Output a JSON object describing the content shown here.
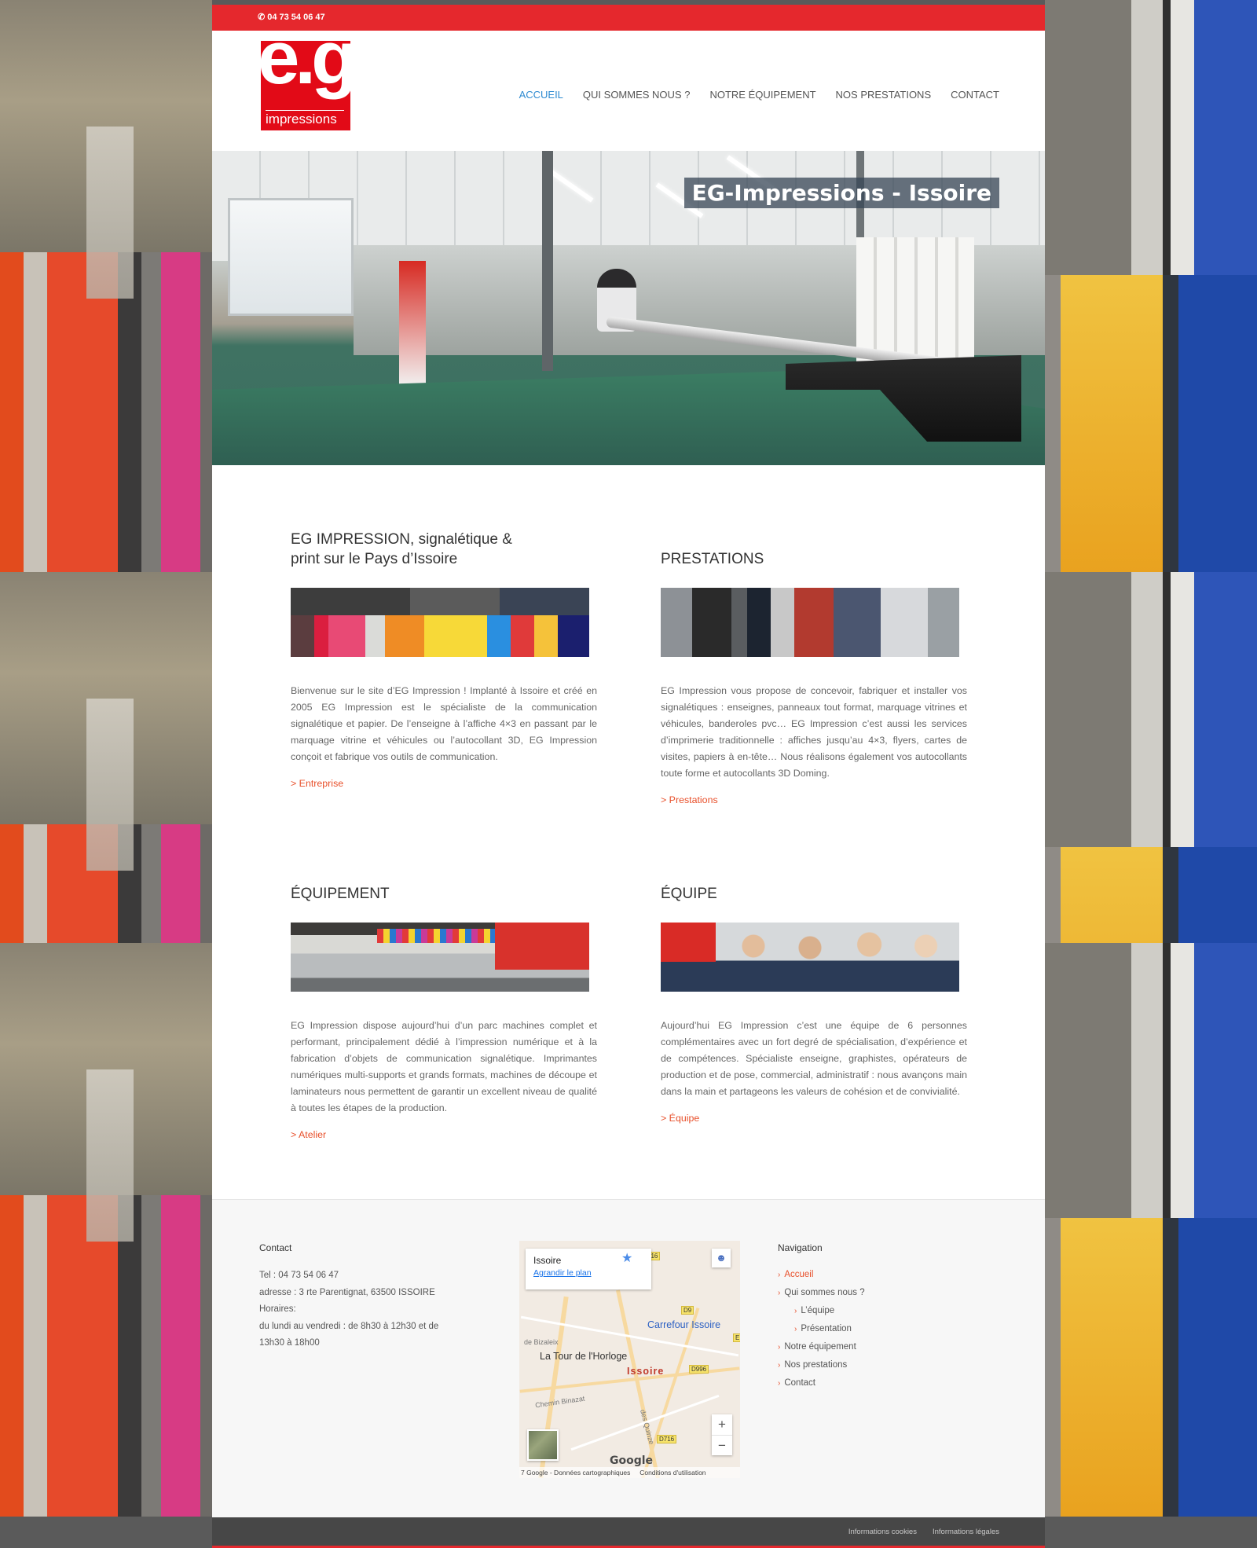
{
  "topbar": {
    "phone_icon": "phone-icon",
    "phone": "04 73 54 06 47"
  },
  "logo": {
    "main": "e.g",
    "sub": "impressions"
  },
  "nav": {
    "items": [
      {
        "label": "ACCUEIL",
        "active": true
      },
      {
        "label": "QUI SOMMES NOUS ?"
      },
      {
        "label": "NOTRE ÉQUIPEMENT"
      },
      {
        "label": "NOS PRESTATIONS"
      },
      {
        "label": "CONTACT"
      }
    ],
    "active_color": "#2f8bd1"
  },
  "hero": {
    "title": "EG-Impressions - Issoire"
  },
  "cards": [
    {
      "title": "EG IMPRESSION, signalétique & print sur le Pays d’Issoire",
      "text": "Bienvenue sur le site d’EG Impression ! Implanté à Issoire et créé en 2005 EG Impression est le spécialiste de la communication signalétique et papier. De l’enseigne à l’affiche 4×3 en passant par le marquage vitrine et véhicules ou l’autocollant 3D, EG Impression conçoit et fabrique vos outils de communication.",
      "link": "> Entreprise"
    },
    {
      "title": "PRESTATIONS",
      "text": "EG Impression vous propose de concevoir, fabriquer et installer vos signalétiques : enseignes, panneaux tout format, marquage vitrines et véhicules, banderoles pvc… EG Impression c’est aussi les services d’imprimerie traditionnelle : affiches jusqu’au 4×3, flyers, cartes de visites, papiers à en-tête… Nous réalisons également vos autocollants toute forme et autocollants 3D Doming.",
      "link": "> Prestations"
    },
    {
      "title": "ÉQUIPEMENT",
      "text": "EG Impression dispose aujourd’hui d’un parc machines complet et performant, principalement dédié à l’impression numérique et à la fabrication d’objets de communication signalétique. Imprimantes numériques multi-supports et grands formats, machines de découpe et laminateurs nous permettent de garantir un excellent niveau de qualité à toutes les étapes de la production.",
      "link": "> Atelier"
    },
    {
      "title": "ÉQUIPE",
      "text": "Aujourd’hui EG Impression c’est une équipe de 6 personnes complémentaires avec un fort degré de spécialisation, d’expérience et de compétences. Spécialiste enseigne, graphistes, opérateurs de production et de pose, commercial, administratif : nous avançons main dans la main et partageons les valeurs de cohésion et de convivialité.",
      "link": "> Équipe"
    }
  ],
  "footer": {
    "contact": {
      "title": "Contact",
      "tel": "Tel : 04 73 54 06 47",
      "address": "adresse : 3 rte Parentignat, 63500 ISSOIRE",
      "hours_label": "Horaires:",
      "hours": "du lundi au vendredi : de 8h30 à 12h30 et de 13h30 à 18h00"
    },
    "map": {
      "place": "Issoire",
      "enlarge": "Agrandir le plan",
      "labels": {
        "carrefour": "Carrefour Issoire",
        "tour": "La Tour de l'Horloge",
        "city": "Issoire",
        "bizaleix": "de Bizaleix",
        "binazat": "Chemin Binazat",
        "quinze": "des Quinze"
      },
      "roads": {
        "r1": "716",
        "r2": "D9",
        "r3": "D996",
        "r4": "D716",
        "r5": "E"
      },
      "zoom_in": "+",
      "zoom_out": "−",
      "google": "Google",
      "attribution": "7 Google - Données cartographiques",
      "terms": "Conditions d'utilisation"
    },
    "navigation": {
      "title": "Navigation",
      "items": [
        {
          "label": "Accueil",
          "active": true
        },
        {
          "label": "Qui sommes nous ?"
        },
        {
          "label": "L’équipe",
          "sub": true
        },
        {
          "label": "Présentation",
          "sub": true
        },
        {
          "label": "Notre équipement"
        },
        {
          "label": "Nos prestations"
        },
        {
          "label": "Contact"
        }
      ]
    }
  },
  "bottombar": {
    "cookies": "Informations cookies",
    "legal": "Informations légales"
  },
  "colors": {
    "brand_red": "#e5282d",
    "link_orange": "#e8502b"
  }
}
